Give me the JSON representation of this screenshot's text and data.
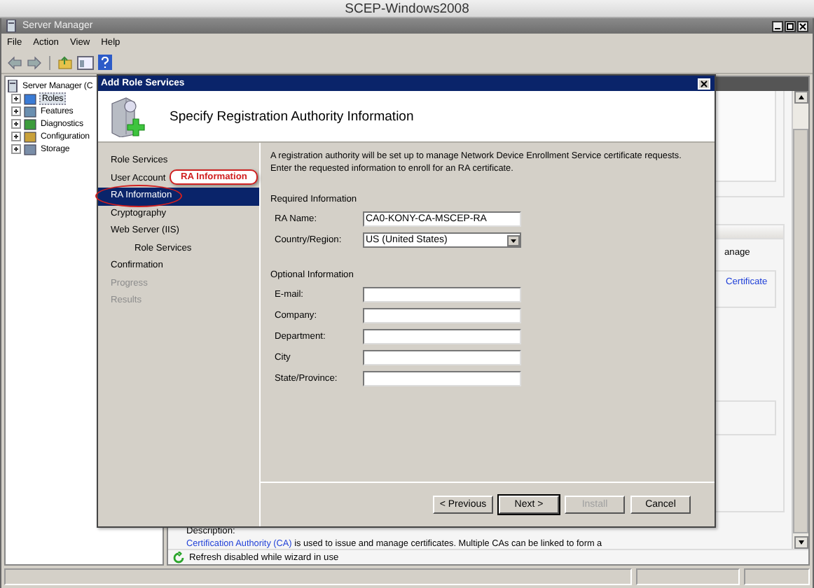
{
  "vm_title": "SCEP-Windows2008",
  "window": {
    "title": "Server Manager"
  },
  "menu": [
    "File",
    "Action",
    "View",
    "Help"
  ],
  "tree": {
    "label": "Server Manager (C",
    "children": [
      {
        "label": "Roles",
        "selected": true
      },
      {
        "label": "Features",
        "selected": false
      },
      {
        "label": "Diagnostics",
        "selected": false
      },
      {
        "label": "Configuration",
        "selected": false
      },
      {
        "label": "Storage",
        "selected": false
      }
    ]
  },
  "background_panel": {
    "fragment": "anage",
    "link": "Certificate",
    "description_label": "Description:",
    "description_link": "Certification Authority (CA)",
    "description_text": " is used to issue and manage certificates. Multiple CAs can be linked to form a",
    "refresh_note": "Refresh disabled while wizard in use"
  },
  "dialog": {
    "title": "Add Role Services",
    "heading": "Specify Registration Authority Information",
    "steps": [
      {
        "label": "Role Services",
        "selected": false,
        "disabled": false
      },
      {
        "label": "User Account",
        "selected": false,
        "disabled": false
      },
      {
        "label": "RA Information",
        "selected": true,
        "disabled": false
      },
      {
        "label": "Cryptography",
        "selected": false,
        "disabled": false
      },
      {
        "label": "Web Server (IIS)",
        "selected": false,
        "disabled": false,
        "children": [
          {
            "label": "Role Services",
            "selected": false,
            "disabled": false
          }
        ]
      },
      {
        "label": "Confirmation",
        "selected": false,
        "disabled": false
      },
      {
        "label": "Progress",
        "selected": false,
        "disabled": true
      },
      {
        "label": "Results",
        "selected": false,
        "disabled": true
      }
    ],
    "callout": "RA Information",
    "intro": "A registration authority will be set up to manage Network Device Enrollment Service certificate requests. Enter the requested information to enroll for an RA certificate.",
    "sections": [
      {
        "heading": "Required Information",
        "fields": [
          {
            "label": "RA Name:",
            "kind": "text",
            "value": "CA0-KONY-CA-MSCEP-RA"
          },
          {
            "label": "Country/Region:",
            "kind": "dropdown",
            "value": "US (United States)"
          }
        ]
      },
      {
        "heading": "Optional Information",
        "fields": [
          {
            "label": "E-mail:",
            "kind": "text"
          },
          {
            "label": "Company:",
            "kind": "text"
          },
          {
            "label": "Department:",
            "kind": "text"
          },
          {
            "label": "City",
            "kind": "text"
          },
          {
            "label": "State/Province:",
            "kind": "text"
          }
        ]
      }
    ],
    "buttons": [
      {
        "label": "< Previous",
        "disabled": false,
        "default": false
      },
      {
        "label": "Next >",
        "disabled": false,
        "default": true
      },
      {
        "label": "Install",
        "disabled": true,
        "default": false
      },
      {
        "label": "Cancel",
        "disabled": false,
        "default": false
      }
    ]
  }
}
